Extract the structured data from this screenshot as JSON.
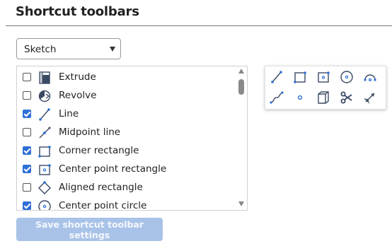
{
  "page": {
    "title": "Shortcut toolbars"
  },
  "dropdown": {
    "selected": "Sketch"
  },
  "list": {
    "items": [
      {
        "label": "Extrude",
        "checked": false,
        "icon": "extrude-icon"
      },
      {
        "label": "Revolve",
        "checked": false,
        "icon": "revolve-icon"
      },
      {
        "label": "Line",
        "checked": true,
        "icon": "line-icon"
      },
      {
        "label": "Midpoint line",
        "checked": false,
        "icon": "midpoint-line-icon"
      },
      {
        "label": "Corner rectangle",
        "checked": true,
        "icon": "corner-rectangle-icon"
      },
      {
        "label": "Center point rectangle",
        "checked": true,
        "icon": "center-point-rectangle-icon"
      },
      {
        "label": "Aligned rectangle",
        "checked": false,
        "icon": "aligned-rectangle-icon"
      },
      {
        "label": "Center point circle",
        "checked": true,
        "icon": "center-point-circle-icon"
      }
    ]
  },
  "save_button": {
    "label": "Save shortcut toolbar settings"
  },
  "preview_toolbar": {
    "icons": [
      "line-icon",
      "corner-rectangle-icon",
      "center-point-rectangle-icon",
      "center-point-circle-icon",
      "arc-icon",
      "spline-icon",
      "point-icon",
      "use-icon",
      "trim-icon",
      "dimension-icon"
    ]
  },
  "colors": {
    "accent": "#2f6fd6",
    "button_disabled": "#a9c3e8",
    "icon": "#3b4a63"
  }
}
